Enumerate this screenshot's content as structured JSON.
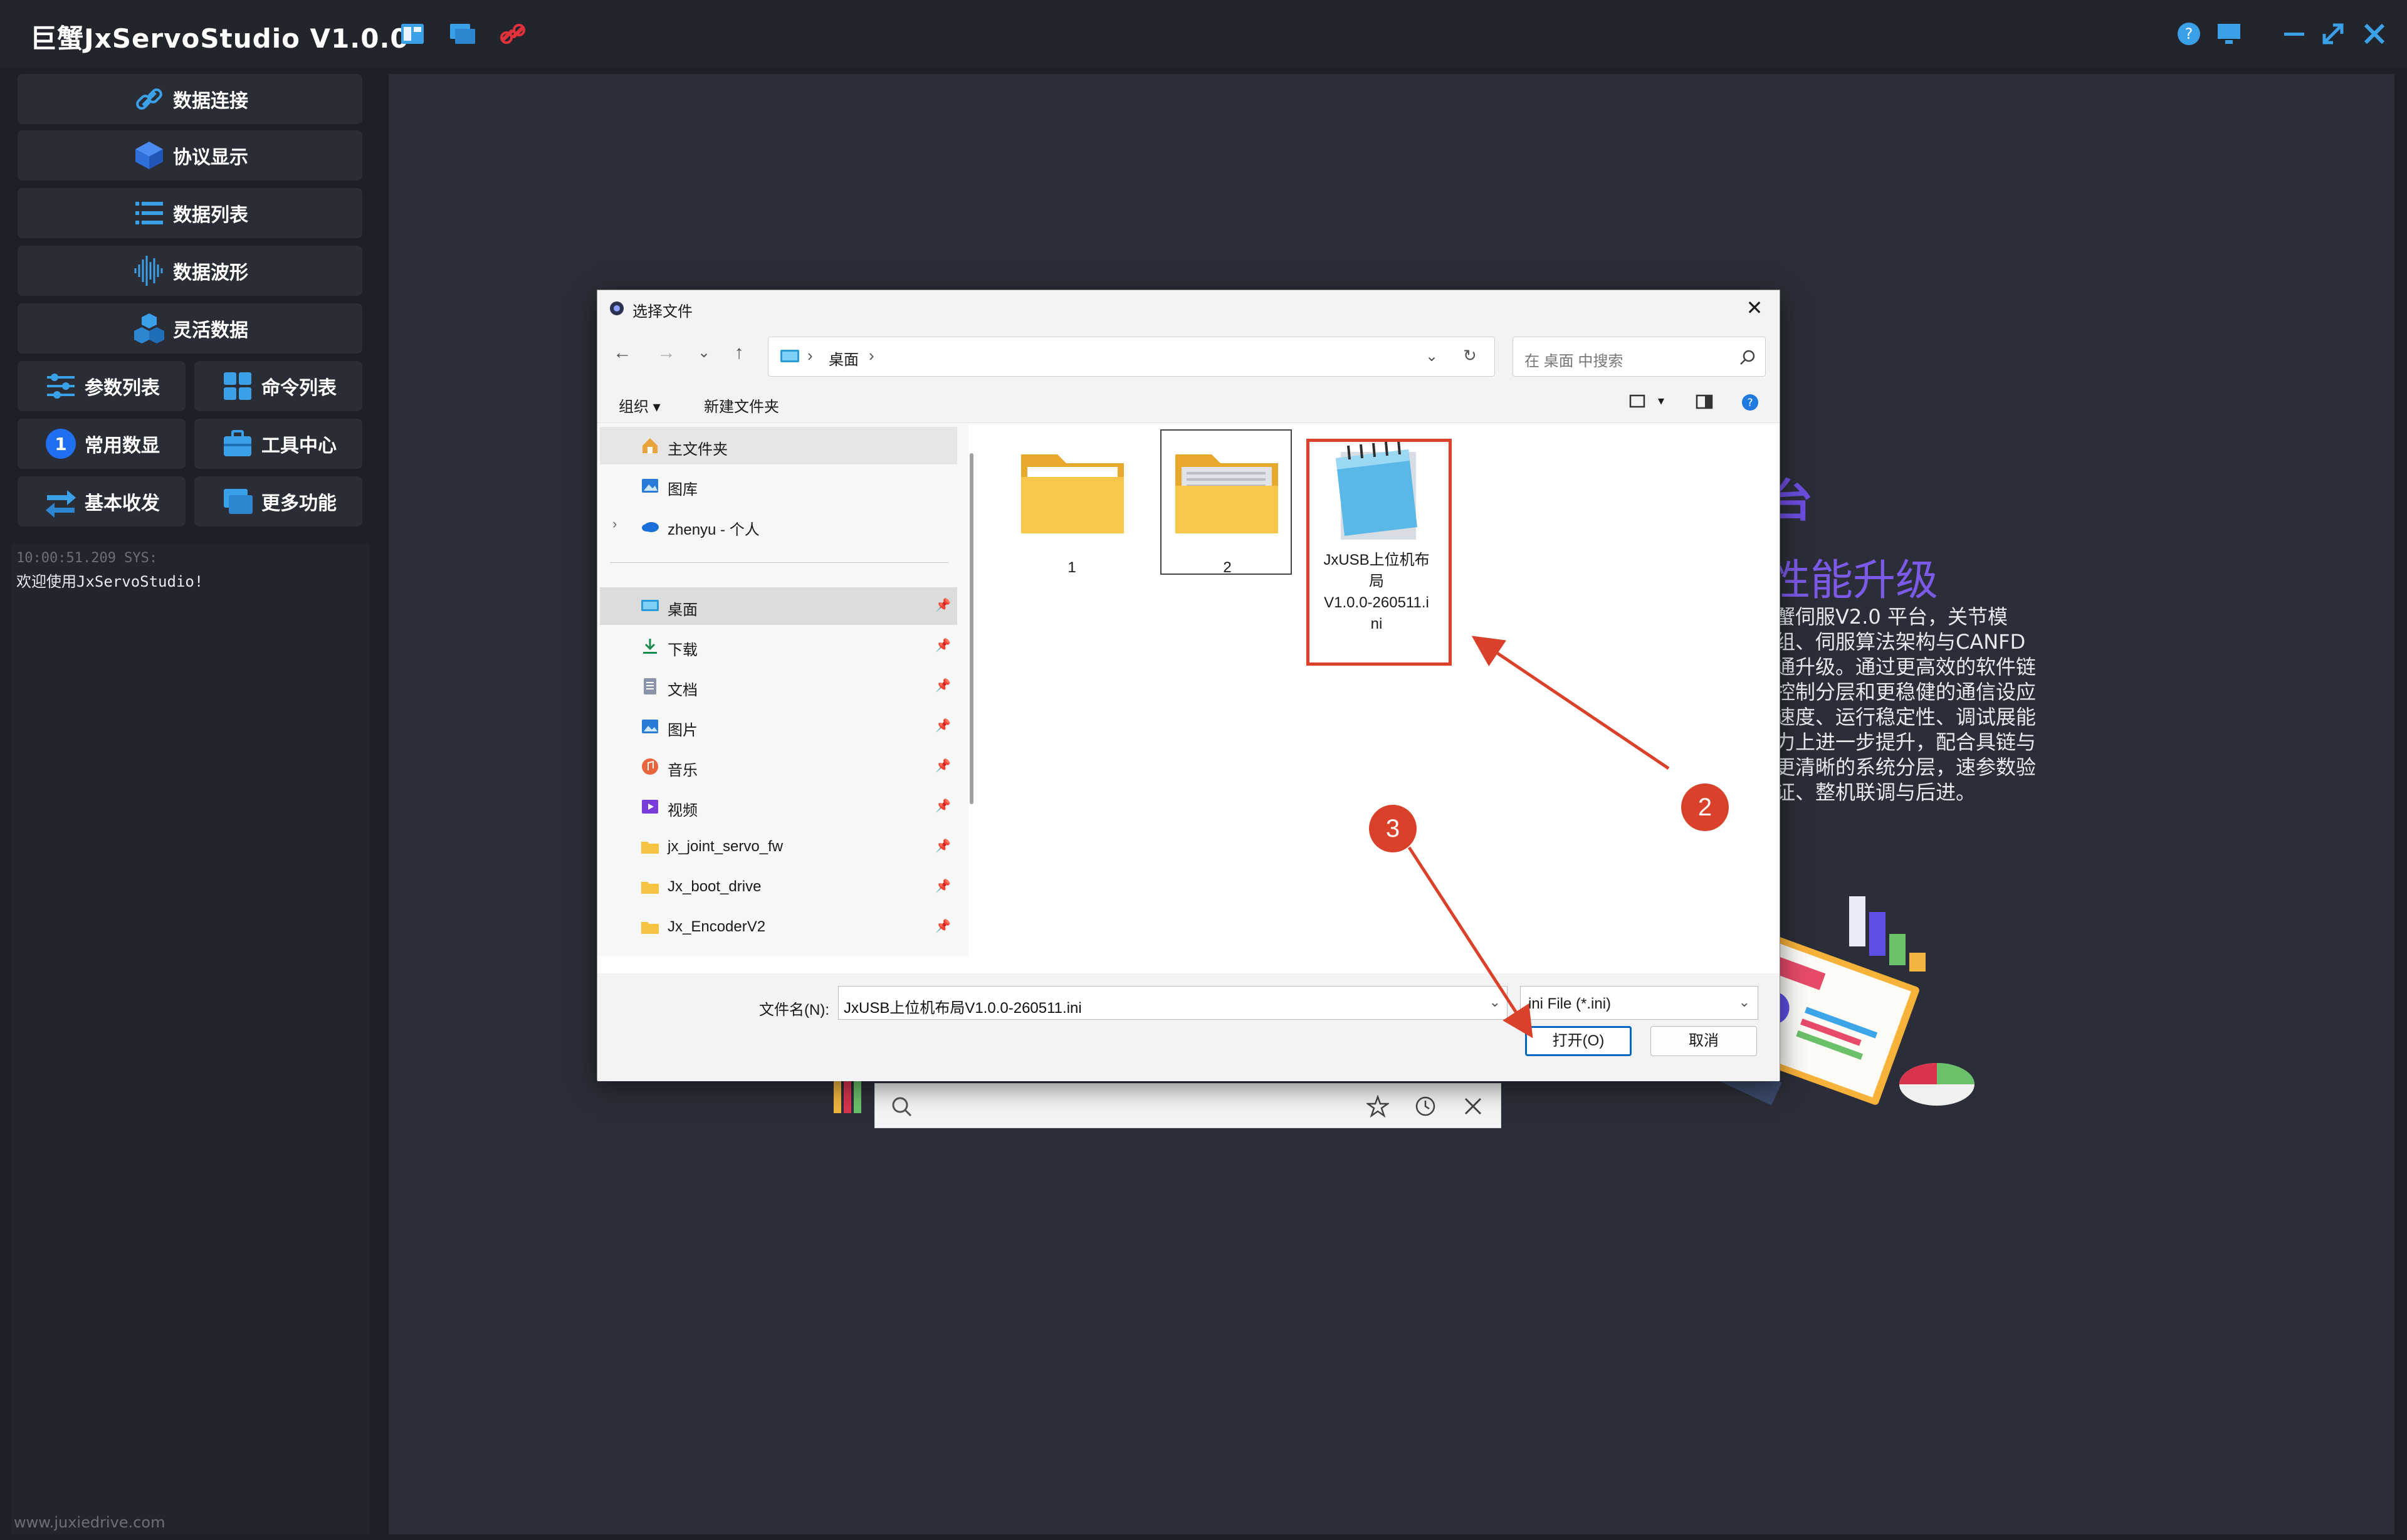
{
  "app": {
    "title": "巨蟹JxServoStudio V1.0.0",
    "toolbar_icons": [
      "layout-icon",
      "monitor-icon",
      "link-broken-icon"
    ],
    "window_icons": [
      "help-icon",
      "screen-icon",
      "minimize-icon",
      "maximize-icon",
      "close-icon"
    ]
  },
  "sidebar": {
    "full_buttons": [
      {
        "label": "数据连接",
        "icon": "link-icon"
      },
      {
        "label": "协议显示",
        "icon": "cube-icon"
      },
      {
        "label": "数据列表",
        "icon": "list-icon"
      },
      {
        "label": "数据波形",
        "icon": "waveform-icon"
      },
      {
        "label": "灵活数据",
        "icon": "blocks-icon"
      }
    ],
    "half_buttons": [
      {
        "label": "参数列表",
        "icon": "sliders-icon"
      },
      {
        "label": "命令列表",
        "icon": "grid-icon"
      },
      {
        "label": "常用数显",
        "icon": "number-one-icon"
      },
      {
        "label": "工具中心",
        "icon": "toolbox-icon"
      },
      {
        "label": "基本收发",
        "icon": "swap-icon"
      },
      {
        "label": "更多功能",
        "icon": "windows-icon"
      }
    ],
    "log": {
      "time": "10:00:51.209 SYS:",
      "message": "欢迎使用JxServoStudio!"
    },
    "footer": "www.juxiedrive.com"
  },
  "background": {
    "title_fragment": "台",
    "subtitle_fragment": "性能升级",
    "paragraph": "蟹伺服V2.0 平台，关节模组、伺服算法架构与CANFD通升级。通过更高效的软件链控制分层和更稳健的通信设应速度、运行稳定性、调试展能力上进一步提升，配合具链与更清晰的系统分层，速参数验证、整机联调与后进。"
  },
  "dialog": {
    "title": "选择文件",
    "nav_back": "←",
    "nav_forward": "→",
    "nav_recent": "⌄",
    "nav_up": "↑",
    "address": "桌面",
    "search_placeholder": "在 桌面 中搜索",
    "organize": "组织 ▾",
    "new_folder": "新建文件夹",
    "nav_items": [
      {
        "label": "主文件夹",
        "icon": "home-icon"
      },
      {
        "label": "图库",
        "icon": "gallery-icon"
      },
      {
        "label": "zhenyu - 个人",
        "icon": "onedrive-icon"
      },
      {
        "label": "桌面",
        "icon": "desktop-icon"
      },
      {
        "label": "下载",
        "icon": "download-icon"
      },
      {
        "label": "文档",
        "icon": "document-icon"
      },
      {
        "label": "图片",
        "icon": "pictures-icon"
      },
      {
        "label": "音乐",
        "icon": "music-icon"
      },
      {
        "label": "视频",
        "icon": "video-icon"
      },
      {
        "label": "jx_joint_servo_fw",
        "icon": "folder-icon"
      },
      {
        "label": "Jx_boot_drive",
        "icon": "folder-icon"
      },
      {
        "label": "Jx_EncoderV2",
        "icon": "folder-icon"
      }
    ],
    "files": [
      {
        "name": "1",
        "type": "folder"
      },
      {
        "name": "2",
        "type": "folder"
      },
      {
        "name": "JxUSB上位机布局V1.0.0-260511.ini",
        "type": "ini"
      }
    ],
    "ini_name_lines": [
      "JxUSB上位机布",
      "局",
      "V1.0.0-260511.i",
      "ni"
    ],
    "filename_label": "文件名(N):",
    "filename_value": "JxUSB上位机布局V1.0.0-260511.ini",
    "filetype": "ini File (*.ini)",
    "open_button": "打开(O)",
    "cancel_button": "取消"
  },
  "annotations": {
    "step2": "2",
    "step3": "3",
    "color": "#d9412a"
  }
}
